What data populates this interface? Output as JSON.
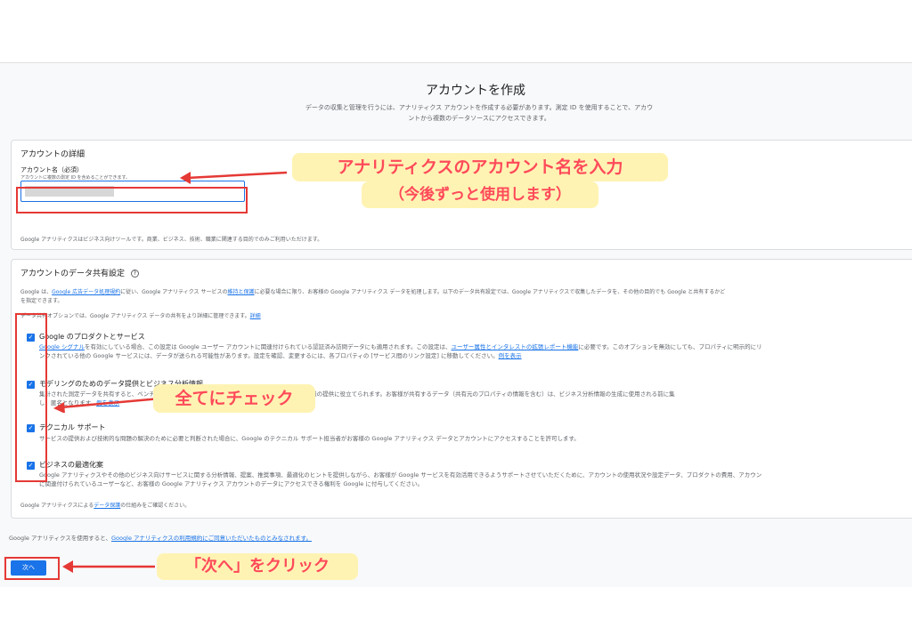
{
  "page": {
    "title": "アカウントを作成",
    "subtitle_line1": "データの収集と管理を行うには、アナリティクス アカウントを作成する必要があります。測定 ID を使用することで、アカウ",
    "subtitle_line2": "ントから複数のデータソースにアクセスできます。"
  },
  "details": {
    "title": "アカウントの詳細",
    "field_label": "アカウント名（必須）",
    "field_hint": "アカウントに複数の測定 ID を含めることができます。",
    "input_value": "",
    "note": "Google アナリティクスはビジネス向けツールです。商業、ビジネス、技術、職業に関連する目的でのみご利用いただけます。"
  },
  "sharing": {
    "title": "アカウントのデータ共有設定",
    "help_icon": "help-icon",
    "intro_pre": "Google は、",
    "intro_link1": "Google 広告データ処理規約",
    "intro_mid": "に従い、Google アナリティクス サービスの",
    "intro_link2": "維持と保護",
    "intro_post": "に必要な場合に限り、お客様の Google アナリティクス データを処理します。以下のデータ共有設定では、Google アナリティクスで収集したデータを、その他の目的でも Google と共有するかど",
    "intro2": "を指定できます。",
    "options_line": "データ共有オプションでは、Google アナリティクス データの共有をより詳細に管理できます。",
    "options_link": "詳細",
    "options": [
      {
        "title": "Google のプロダクトとサービス",
        "desc1_link": "Google シグナル",
        "desc1": "を有効にしている場合、この設定は Google ユーザー アカウントに関連付けられている認証済み訪問データにも適用されます。この設定は、",
        "desc1_link2": "ユーザー属性とインタレストの拡張レポート機能",
        "desc1_post": "に必要です。このオプションを無効にしても、プロパティに明示的にリ",
        "desc2": "ンクされている他の Google サービスには、データが送られる可能性があります。設定を確認、変更するには、各プロパティの [サービス間のリンク設定] に移動してください。",
        "desc2_link": "例を表示",
        "checked": true
      },
      {
        "title": "モデリングのためのデータ提供とビジネス分析情報",
        "desc1": "集計された測定データを共有すると、ベンチマークなどに利用され、ビジネスに関するより豊富な分析情報の提供に役立てられます。お客様が共有するデータ（共有元のプロパティの情報を含む）は、ビジネス分析情報の生成に使用される前に集",
        "desc2": "し、匿名となります。",
        "desc2_link": "例を表示",
        "checked": true
      },
      {
        "title": "テクニカル サポート",
        "desc1": "サービスの提供および技術的な問題の解決のために必要と判断された場合に、Google のテクニカル サポート担当者がお客様の Google アナリティクス データとアカウントにアクセスすることを許可します。",
        "checked": true
      },
      {
        "title": "ビジネスの最適化案",
        "desc1": "Google アナリティクスやその他のビジネス向けサービスに関する分析情報、提案、推奨事項、最適化のヒントを提供しながら、お客様が Google サービスを有効活用できるようサポートさせていただくために、アカウントの使用状況や設定データ、プロダクトの費用、アカウン",
        "desc2": "に関連付けられているユーザーなど、お客様の Google アナリティクス アカウントのデータにアクセスできる権利を Google に付与してください。",
        "checked": true
      }
    ],
    "footer_pre": "Google アナリティクスによる",
    "footer_link": "データ保護",
    "footer_post": "の仕組みをご確認ください。"
  },
  "terms": {
    "pre": "Google アナリティクスを使用すると、",
    "link": "Google アナリティクスの利用規約にご同意いただいたものとみなされます。"
  },
  "next_button": "次へ",
  "annotations": {
    "callout1_line1": "アナリティクスのアカウント名を入力",
    "callout1_line2": "（今後ずっと使用します）",
    "callout2": "全てにチェック",
    "callout3": "「次へ」をクリック"
  },
  "colors": {
    "accent": "#1a73e8",
    "annotation_red": "#e53935",
    "callout_bg": "#fff3b3",
    "callout_text": "#ff4a5a"
  }
}
